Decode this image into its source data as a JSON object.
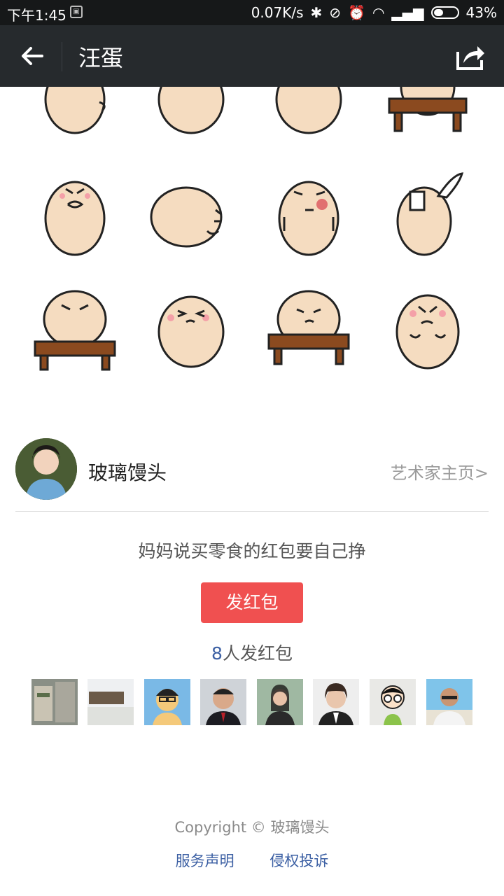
{
  "status_bar": {
    "time": "下午1:45",
    "network_speed": "0.07K/s",
    "battery": "43%",
    "battery_level": 0.43
  },
  "nav": {
    "title": "汪蛋"
  },
  "artist": {
    "name": "玻璃馒头",
    "homepage_link": "艺术家主页>"
  },
  "tip": {
    "slogan": "妈妈说买零食的红包要自己挣",
    "button_label": "发红包",
    "count": "8",
    "count_suffix": "人发红包"
  },
  "footer": {
    "copyright": "Copyright © 玻璃馒头",
    "links": [
      "服务声明",
      "侵权投诉"
    ]
  },
  "colors": {
    "accent_red": "#f05050",
    "link_blue": "#3b5fa3",
    "sticker_skin": "#f5dcc0",
    "desk": "#8b4a1f"
  }
}
